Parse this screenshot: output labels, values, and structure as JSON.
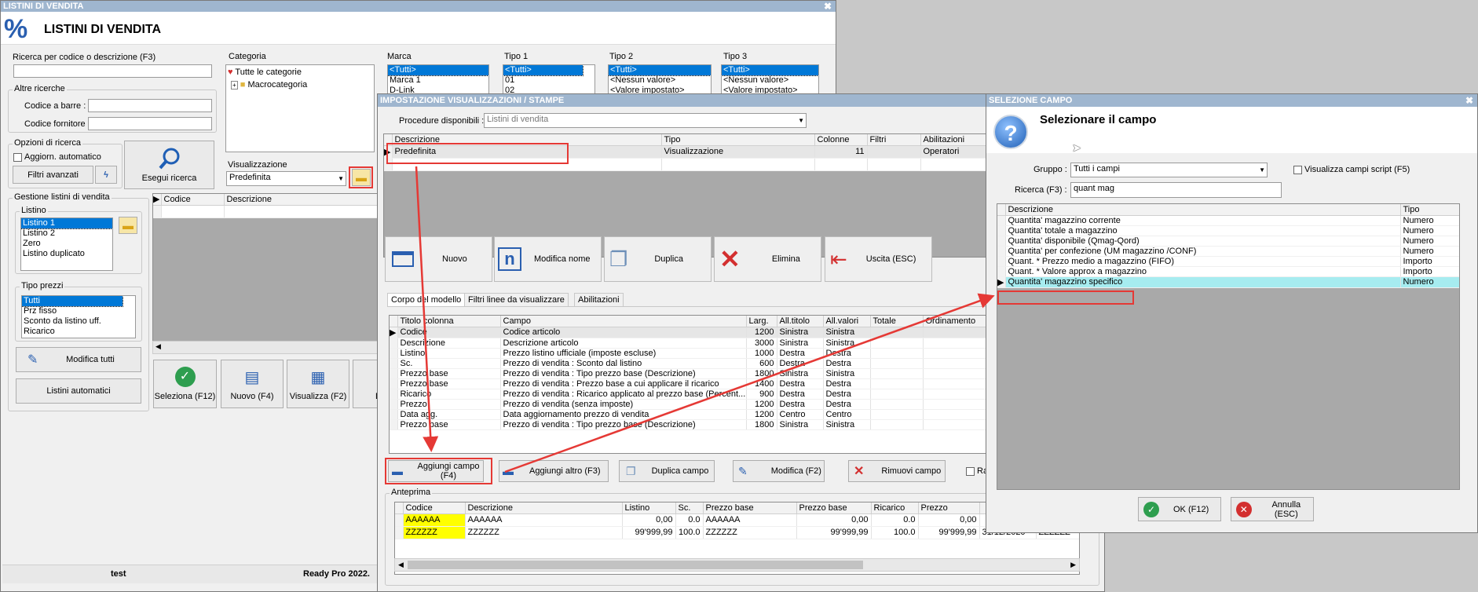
{
  "w1": {
    "title": "LISTINI DI VENDITA",
    "header": "LISTINI DI VENDITA",
    "percent": "%",
    "search_label": "Ricerca per codice o descrizione (F3)",
    "other_label": "Altre ricerche",
    "barcode_label": "Codice a barre :",
    "supplier_label": "Codice fornitore :",
    "opts_label": "Opzioni di ricerca",
    "auto_label": "Aggiorn. automatico",
    "adv_filters": "Filtri avanzati",
    "exec_search": "Esegui ricerca",
    "cat_label": "Categoria",
    "cat_all": "Tutte le categorie",
    "cat_macro": "Macrocategoria",
    "vis_label": "Visualizzazione",
    "vis_value": "Predefinita",
    "marca_label": "Marca",
    "marca_items": [
      "<Tutti>",
      "Marca 1",
      "D-Link"
    ],
    "tipo1_label": "Tipo 1",
    "tipo1_items": [
      "<Tutti>",
      "01",
      "02"
    ],
    "tipo2_label": "Tipo 2",
    "tipo2_items": [
      "<Tutti>",
      "<Nessun valore>",
      "<Valore impostato>"
    ],
    "tipo3_label": "Tipo 3",
    "tipo3_items": [
      "<Tutti>",
      "<Nessun valore>",
      "<Valore impostato>"
    ],
    "gestione_label": "Gestione listini di vendita",
    "listino_label": "Listino",
    "listino_items": [
      "Listino 1",
      "Listino 2",
      "Zero",
      "Listino duplicato"
    ],
    "tipoprezzi_label": "Tipo prezzi",
    "tipoprezzi_items": [
      "Tutti",
      "Prz fisso",
      "Sconto da listino uff.",
      "Ricarico"
    ],
    "modifica_tutti": "Modifica tutti",
    "listini_auto": "Listini automatici",
    "grid_headers": [
      "Codice",
      "Descrizione"
    ],
    "toolbar": [
      "Seleziona (F12)",
      "Nuovo (F4)",
      "Visualizza (F2)",
      "D"
    ],
    "status_user": "test",
    "status_app": "Ready Pro 2022."
  },
  "w2": {
    "title": "IMPOSTAZIONE VISUALIZZAZIONI / STAMPE",
    "proc_label": "Procedure disponibili :",
    "proc_value": "Listini di vendita",
    "top_headers": [
      "Descrizione",
      "Tipo",
      "Colonne",
      "Filtri",
      "Abilitazioni"
    ],
    "top_row": {
      "desc": "Predefinita",
      "tipo": "Visualizzazione",
      "col": "11",
      "filtri": "",
      "abil": "Operatori"
    },
    "buttons": [
      "Nuovo",
      "Modifica nome",
      "Duplica",
      "Elimina",
      "Uscita (ESC)"
    ],
    "tabs": [
      "Corpo del modello",
      "Filtri linee da visualizzare",
      "Abilitazioni"
    ],
    "mid_headers": [
      "Titolo colonna",
      "Campo",
      "Larg.",
      "All.titolo",
      "All.valori",
      "Totale",
      "Ordinamento"
    ],
    "mid_rows": [
      [
        "Codice",
        "Codice articolo",
        "1200",
        "Sinistra",
        "Sinistra"
      ],
      [
        "Descrizione",
        "Descrizione articolo",
        "3000",
        "Sinistra",
        "Sinistra"
      ],
      [
        "Listino",
        "Prezzo listino ufficiale (imposte escluse)",
        "1000",
        "Destra",
        "Destra"
      ],
      [
        "Sc.",
        "Prezzo di vendita : Sconto dal listino",
        "600",
        "Destra",
        "Destra"
      ],
      [
        "Prezzo base",
        "Prezzo di vendita : Tipo prezzo base (Descrizione)",
        "1800",
        "Sinistra",
        "Sinistra"
      ],
      [
        "Prezzo base",
        "Prezzo di vendita : Prezzo base a cui applicare il ricarico",
        "1400",
        "Destra",
        "Destra"
      ],
      [
        "Ricarico",
        "Prezzo di vendita : Ricarico applicato al prezzo base (Percent...",
        "900",
        "Destra",
        "Destra"
      ],
      [
        "Prezzo",
        "Prezzo di vendita (senza imposte)",
        "1200",
        "Destra",
        "Destra"
      ],
      [
        "Data agg.",
        "Data aggiornamento prezzo di vendita",
        "1200",
        "Centro",
        "Centro"
      ],
      [
        "Prezzo base",
        "Prezzo di vendita : Tipo prezzo base (Descrizione)",
        "1800",
        "Sinistra",
        "Sinistra"
      ]
    ],
    "field_buttons": [
      "Aggiungi campo (F4)",
      "Aggiungi altro (F3)",
      "Duplica campo",
      "Modifica (F2)",
      "Rimuovi campo",
      "Ra"
    ],
    "preview_label": "Anteprima",
    "prev_headers": [
      "Codice",
      "Descrizione",
      "Listino",
      "Sc.",
      "Prezzo base",
      "Prezzo base",
      "Ricarico",
      "Prezzo",
      "",
      ""
    ],
    "prev_rows": [
      [
        "AAAAAA",
        "AAAAAA",
        "0,00",
        "0.0",
        "AAAAAA",
        "0,00",
        "0.0",
        "0,00",
        "",
        ""
      ],
      [
        "ZZZZZZ",
        "ZZZZZZ",
        "99'999,99",
        "100.0",
        "ZZZZZZ",
        "99'999,99",
        "100.0",
        "99'999,99",
        "31/12/2020",
        "ZZZZZZ"
      ]
    ]
  },
  "w3": {
    "title": "SELEZIONE CAMPO",
    "header": "Selezionare il campo",
    "gruppo_label": "Gruppo :",
    "gruppo_value": "Tutti i campi",
    "script_label": "Visualizza campi script (F5)",
    "ricerca_label": "Ricerca (F3) :",
    "ricerca_value": "quant mag",
    "headers": [
      "Descrizione",
      "Tipo"
    ],
    "rows": [
      [
        "Quantita' magazzino corrente",
        "Numero"
      ],
      [
        "Quantita' totale a magazzino",
        "Numero"
      ],
      [
        "Quantita' disponibile (Qmag-Qord)",
        "Numero"
      ],
      [
        "Quantita' per confezione (UM magazzino /CONF)",
        "Numero"
      ],
      [
        "Quant. * Prezzo medio a magazzino (FIFO)",
        "Importo"
      ],
      [
        "Quant. * Valore approx a magazzino",
        "Importo"
      ],
      [
        "Quantita' magazzino specifico",
        "Numero"
      ]
    ],
    "ok": "OK (F12)",
    "cancel": "Annulla (ESC)"
  },
  "colors": {
    "accent": "#0078d7",
    "title_bar": "#9fb6cf",
    "highlight_red": "#e53935",
    "selected_row": "#a6ecf0",
    "preview_yellow": "#ffff00"
  }
}
